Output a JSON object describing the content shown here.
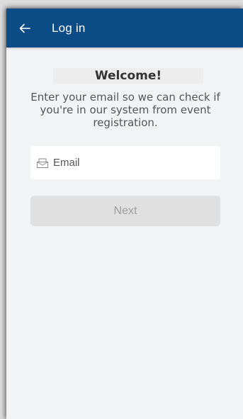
{
  "app_bar": {
    "title": "Log in",
    "back_icon": "arrow-left-icon",
    "background_color": "#0b4b86"
  },
  "content": {
    "welcome": "Welcome!",
    "intro": "Enter your email so we can check if you're in our system from event registration."
  },
  "email_field": {
    "placeholder": "Email",
    "value": "",
    "icon": "envelope-icon"
  },
  "next_button": {
    "label": "Next",
    "state": "disabled"
  }
}
